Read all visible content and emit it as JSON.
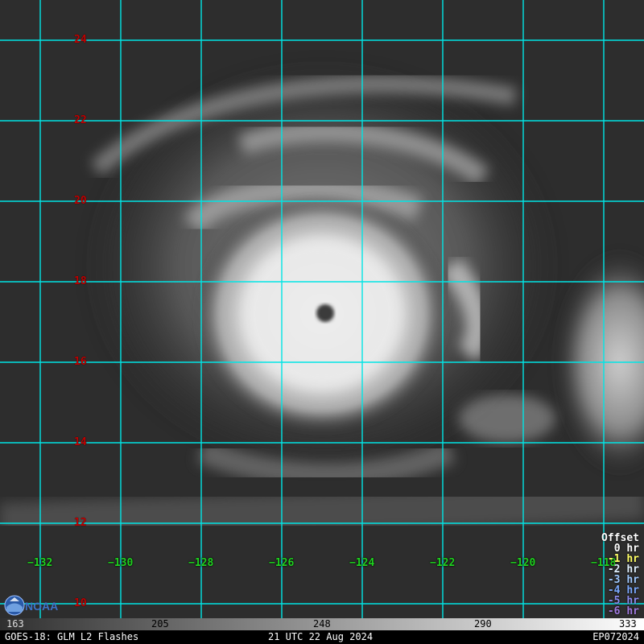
{
  "map": {
    "lat_labels": [
      "24",
      "22",
      "20",
      "18",
      "16",
      "14",
      "12",
      "10"
    ],
    "lon_labels": [
      "−132",
      "−130",
      "−128",
      "−126",
      "−124",
      "−122",
      "−120",
      "−118"
    ],
    "grid_color": "#00e5e5",
    "lat_label_color": "#c00000",
    "lon_label_color": "#1fd21f"
  },
  "legend": {
    "title": "Offset",
    "items": [
      {
        "label": "0 hr",
        "color": "#ffffff"
      },
      {
        "label": "-1 hr",
        "color": "#ffff66"
      },
      {
        "label": "-2 hr",
        "color": "#e0f0ff"
      },
      {
        "label": "-3 hr",
        "color": "#a0c8ff"
      },
      {
        "label": "-4 hr",
        "color": "#7aa8ff"
      },
      {
        "label": "-5 hr",
        "color": "#8c8cf0"
      },
      {
        "label": "-6 hr",
        "color": "#a07ae0"
      }
    ]
  },
  "colorbar": {
    "ticks": [
      "163",
      "205",
      "248",
      "290",
      "333"
    ]
  },
  "footer": {
    "left": "GOES-18: GLM L2 Flashes",
    "center": "21 UTC 22 Aug 2024",
    "right": "EP072024"
  },
  "logo": {
    "text": "NOAA",
    "icon": "noaa-logo-icon"
  }
}
